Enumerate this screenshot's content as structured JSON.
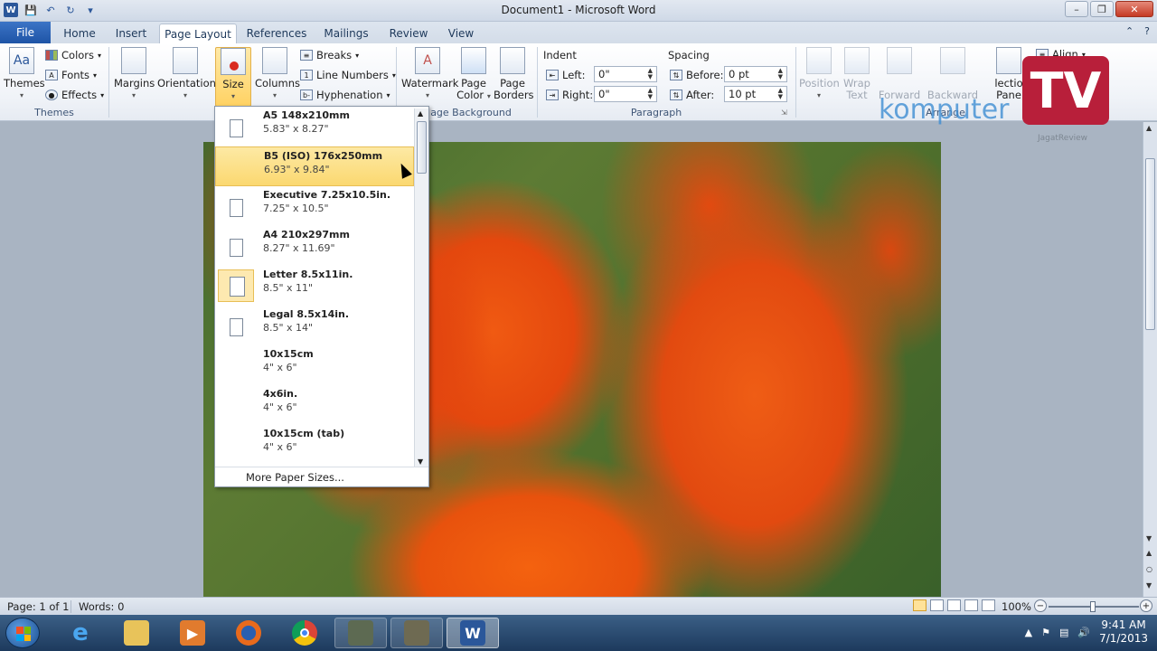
{
  "window": {
    "title": "Document1 - Microsoft Word",
    "app_letter": "W"
  },
  "tabs": [
    {
      "label": "File"
    },
    {
      "label": "Home"
    },
    {
      "label": "Insert"
    },
    {
      "label": "Page Layout"
    },
    {
      "label": "References"
    },
    {
      "label": "Mailings"
    },
    {
      "label": "Review"
    },
    {
      "label": "View"
    }
  ],
  "ribbon": {
    "themes": {
      "label": "Themes",
      "group": "Themes",
      "colors": "Colors",
      "fonts": "Fonts",
      "effects": "Effects"
    },
    "page_setup": {
      "margins": "Margins",
      "orientation": "Orientation",
      "size": "Size",
      "columns": "Columns",
      "breaks": "Breaks",
      "line_numbers": "Line Numbers",
      "hyphenation": "Hyphenation"
    },
    "page_background": {
      "group": "age Background",
      "watermark": "Watermark",
      "page_color_1": "Page",
      "page_color_2": "Color",
      "page_borders_1": "Page",
      "page_borders_2": "Borders"
    },
    "paragraph": {
      "group": "Paragraph",
      "indent_title": "Indent",
      "left_label": "Left:",
      "left_value": "0\"",
      "right_label": "Right:",
      "right_value": "0\"",
      "spacing_title": "Spacing",
      "before_label": "Before:",
      "before_value": "0 pt",
      "after_label": "After:",
      "after_value": "10 pt"
    },
    "arrange": {
      "group": "Arrange",
      "position": "Position",
      "wrap_1": "Wrap",
      "wrap_2": "Text",
      "forward": "Forward",
      "backward": "Backward",
      "selection_1": "lectio",
      "selection_2": "Pane",
      "align": "Align"
    }
  },
  "size_menu": {
    "items": [
      {
        "name": "A5 148x210mm",
        "dims": "5.83\" x 8.27\""
      },
      {
        "name": "B5 (ISO) 176x250mm",
        "dims": "6.93\" x 9.84\""
      },
      {
        "name": "Executive 7.25x10.5in.",
        "dims": "7.25\" x 10.5\""
      },
      {
        "name": "A4 210x297mm",
        "dims": "8.27\" x 11.69\""
      },
      {
        "name": "Letter 8.5x11in.",
        "dims": "8.5\" x 11\""
      },
      {
        "name": "Legal 8.5x14in.",
        "dims": "8.5\" x 14\""
      },
      {
        "name": "10x15cm",
        "dims": "4\" x 6\""
      },
      {
        "name": "4x6in.",
        "dims": "4\" x 6\""
      },
      {
        "name": "10x15cm (tab)",
        "dims": "4\" x 6\""
      }
    ],
    "hovered_item": "B5 (ISO) 176x250mm",
    "selected_item": "Letter 8.5x11in.",
    "more": "More Paper Sizes..."
  },
  "watermark": {
    "brand": "komputer",
    "tv": "TV",
    "sub": "JagatReview"
  },
  "status": {
    "page": "Page: 1 of 1",
    "words": "Words: 0",
    "zoom": "100%"
  },
  "taskbar": {
    "time": "9:41 AM",
    "date": "7/1/2013"
  }
}
